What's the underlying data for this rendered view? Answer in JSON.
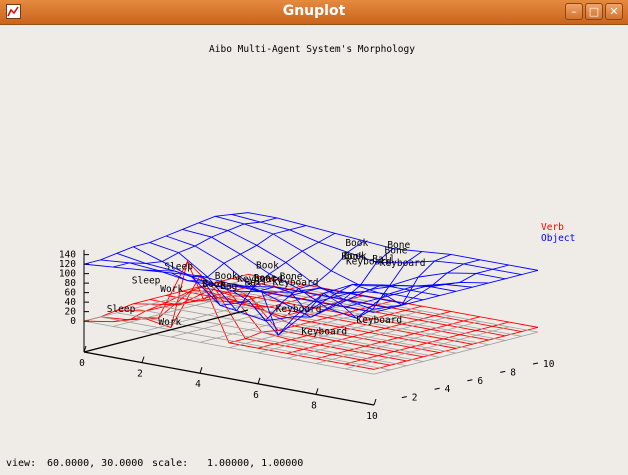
{
  "window": {
    "title": "Gnuplot",
    "icon": "gnuplot-icon",
    "controls": [
      "minimize-icon",
      "maximize-icon",
      "close-icon"
    ]
  },
  "status": {
    "view_label": "view:",
    "view_value": "60.0000,  30.0000",
    "scale_label": "scale:",
    "scale_value": "1.00000,  1.00000"
  },
  "colors": {
    "verb": "#ff0000",
    "object": "#0000ff",
    "grid": "#a0a0a0"
  },
  "chart_data": {
    "type": "surface3d",
    "title": "Aibo Multi-Agent System's Morphology",
    "xlabel": "",
    "ylabel": "",
    "zlabel": "",
    "xlim": [
      0,
      10
    ],
    "ylim": [
      0,
      10
    ],
    "zlim": [
      0,
      150
    ],
    "x_ticks": [
      "0",
      "2",
      "4",
      "6",
      "8",
      "10"
    ],
    "y_ticks": [
      "2",
      "4",
      "6",
      "8",
      "10"
    ],
    "z_ticks": [
      "0",
      "20",
      "40",
      "60",
      "80",
      "100",
      "120",
      "140"
    ],
    "view": [
      60,
      30
    ],
    "legend": {
      "position": "right",
      "entries": [
        "Verb",
        "Object"
      ]
    },
    "series": [
      {
        "name": "Verb",
        "color": "#ff0000",
        "grid_rows": [
          [
            0,
            10,
            30,
            20,
            140,
            10,
            10,
            10,
            10,
            10,
            10
          ],
          [
            0,
            5,
            20,
            150,
            100,
            10,
            10,
            10,
            10,
            10,
            10
          ],
          [
            5,
            15,
            40,
            60,
            80,
            15,
            10,
            10,
            10,
            10,
            10
          ],
          [
            10,
            20,
            60,
            90,
            70,
            10,
            10,
            10,
            10,
            10,
            10
          ],
          [
            10,
            10,
            50,
            40,
            30,
            10,
            10,
            10,
            10,
            10,
            10
          ],
          [
            10,
            10,
            20,
            20,
            10,
            10,
            10,
            10,
            10,
            10,
            10
          ],
          [
            10,
            10,
            10,
            10,
            10,
            10,
            10,
            10,
            10,
            10,
            10
          ],
          [
            10,
            10,
            10,
            10,
            10,
            10,
            10,
            10,
            10,
            10,
            10
          ],
          [
            10,
            10,
            10,
            10,
            10,
            10,
            10,
            10,
            10,
            10,
            10
          ],
          [
            10,
            10,
            10,
            10,
            10,
            10,
            10,
            10,
            10,
            10,
            10
          ],
          [
            10,
            10,
            10,
            10,
            10,
            10,
            10,
            10,
            10,
            10,
            10
          ]
        ]
      },
      {
        "name": "Object",
        "color": "#0000ff",
        "grid_rows": [
          [
            120,
            125,
            130,
            135,
            140,
            135,
            130,
            130,
            130,
            130,
            130
          ],
          [
            120,
            125,
            120,
            110,
            110,
            120,
            130,
            130,
            130,
            130,
            130
          ],
          [
            125,
            115,
            110,
            100,
            90,
            100,
            110,
            130,
            130,
            130,
            130
          ],
          [
            130,
            110,
            90,
            40,
            60,
            0,
            60,
            110,
            125,
            130,
            130
          ],
          [
            130,
            120,
            80,
            20,
            10,
            30,
            90,
            120,
            130,
            130,
            130
          ],
          [
            135,
            125,
            100,
            60,
            40,
            20,
            60,
            100,
            120,
            130,
            130
          ],
          [
            140,
            135,
            110,
            80,
            60,
            30,
            20,
            80,
            110,
            125,
            130
          ],
          [
            145,
            140,
            120,
            95,
            60,
            40,
            30,
            50,
            100,
            120,
            130
          ],
          [
            150,
            145,
            135,
            110,
            80,
            60,
            70,
            100,
            120,
            130,
            130
          ],
          [
            145,
            140,
            135,
            120,
            110,
            100,
            110,
            125,
            130,
            130,
            130
          ],
          [
            140,
            140,
            135,
            130,
            125,
            120,
            125,
            130,
            130,
            130,
            130
          ]
        ]
      }
    ],
    "annotations": [
      {
        "text": "Sleep",
        "x": 0.5,
        "y": 0.5,
        "z": 20
      },
      {
        "text": "Work",
        "x": 2.0,
        "y": 1.0,
        "z": 5
      },
      {
        "text": "Sleep",
        "x": 0.8,
        "y": 1.5,
        "z": 75
      },
      {
        "text": "Work",
        "x": 1.5,
        "y": 2.0,
        "z": 60
      },
      {
        "text": "Sleep",
        "x": 1.3,
        "y": 2.6,
        "z": 100
      },
      {
        "text": "Book",
        "x": 2.5,
        "y": 2.8,
        "z": 75
      },
      {
        "text": "Book",
        "x": 2.7,
        "y": 3.2,
        "z": 90
      },
      {
        "text": "Bag",
        "x": 3.0,
        "y": 3.0,
        "z": 75
      },
      {
        "text": "Keyboard",
        "x": 3.3,
        "y": 3.5,
        "z": 88
      },
      {
        "text": "Ball",
        "x": 3.5,
        "y": 3.6,
        "z": 82
      },
      {
        "text": "Bone",
        "x": 3.7,
        "y": 3.8,
        "z": 92
      },
      {
        "text": "Keyboard",
        "x": 4.3,
        "y": 3.9,
        "z": 88
      },
      {
        "text": "Bone",
        "x": 4.2,
        "y": 4.5,
        "z": 95
      },
      {
        "text": "Book",
        "x": 3.5,
        "y": 4.3,
        "z": 112
      },
      {
        "text": "Keyboard",
        "x": 3.5,
        "y": 5.5,
        "z": 10
      },
      {
        "text": "Keyboard",
        "x": 6.0,
        "y": 6.0,
        "z": 10
      },
      {
        "text": "Keyboard",
        "x": 5.8,
        "y": 3.0,
        "z": 10
      },
      {
        "text": "Keyboard",
        "x": 5.3,
        "y": 6.6,
        "z": 120
      },
      {
        "text": "Book",
        "x": 5.0,
        "y": 7.0,
        "z": 125
      },
      {
        "text": "Book",
        "x": 4.8,
        "y": 7.2,
        "z": 120
      },
      {
        "text": "Book",
        "x": 4.6,
        "y": 7.8,
        "z": 140
      },
      {
        "text": "Ball",
        "x": 5.7,
        "y": 7.5,
        "z": 122
      },
      {
        "text": "Keyboard",
        "x": 5.9,
        "y": 7.6,
        "z": 115
      },
      {
        "text": "Bone",
        "x": 5.5,
        "y": 8.6,
        "z": 128
      },
      {
        "text": "Bone",
        "x": 5.2,
        "y": 9.3,
        "z": 130
      }
    ]
  }
}
